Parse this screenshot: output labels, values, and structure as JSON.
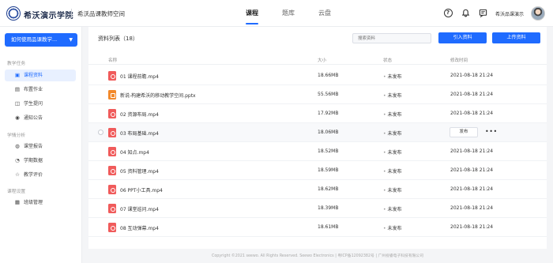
{
  "header": {
    "school_name": "希沃演示学院",
    "space_name": "希沃品课教师空间",
    "nav": [
      {
        "label": "课程",
        "active": true
      },
      {
        "label": "题库",
        "active": false
      },
      {
        "label": "云盘",
        "active": false
      }
    ],
    "icons": [
      "help-icon",
      "bell-icon",
      "message-icon"
    ],
    "user_name": "希沃品课演示"
  },
  "sidebar": {
    "selector_label": "如何使用品课教学...",
    "groups": [
      {
        "title": "教学任务",
        "items": [
          {
            "label": "课程资料",
            "icon": "video-icon",
            "active": true
          },
          {
            "label": "布置作业",
            "icon": "homework-icon",
            "active": false
          },
          {
            "label": "学生提问",
            "icon": "question-icon",
            "active": false
          },
          {
            "label": "通知公告",
            "icon": "announce-icon",
            "active": false
          }
        ]
      },
      {
        "title": "学情分析",
        "items": [
          {
            "label": "课堂报告",
            "icon": "report-icon",
            "active": false
          },
          {
            "label": "学期数据",
            "icon": "data-icon",
            "active": false
          },
          {
            "label": "教学评价",
            "icon": "rating-icon",
            "active": false
          }
        ]
      },
      {
        "title": "课程设置",
        "items": [
          {
            "label": "班级管理",
            "icon": "class-icon",
            "active": false
          }
        ]
      }
    ]
  },
  "main": {
    "list_title": "资料列表（18）",
    "search_placeholder": "搜索资料",
    "import_label": "引入资料",
    "upload_label": "上传资料",
    "columns": {
      "name": "名称",
      "size": "大小",
      "status": "状态",
      "date": "修改时间"
    },
    "rows": [
      {
        "name": "01 课程前瞻.mp4",
        "type": "video",
        "size": "18.66MB",
        "status": "未发布",
        "date": "2021-08-18 21:24"
      },
      {
        "name": "新说-构建希沃的移动教学空间.pptx",
        "type": "ppt",
        "size": "55.56MB",
        "status": "未发布",
        "date": "2021-08-18 21:24"
      },
      {
        "name": "02 资源布局.mp4",
        "type": "video",
        "size": "17.92MB",
        "status": "未发布",
        "date": "2021-08-18 21:24"
      },
      {
        "name": "03 布局基础.mp4",
        "type": "video",
        "size": "18.06MB",
        "status": "未发布",
        "date": "",
        "hover": true
      },
      {
        "name": "04 知点.mp4",
        "type": "video",
        "size": "18.52MB",
        "status": "未发布",
        "date": "2021-08-18 21:24"
      },
      {
        "name": "05 资料管理.mp4",
        "type": "video",
        "size": "18.59MB",
        "status": "未发布",
        "date": "2021-08-18 21:24"
      },
      {
        "name": "06 PPT小工具.mp4",
        "type": "video",
        "size": "18.62MB",
        "status": "未发布",
        "date": "2021-08-18 21:24"
      },
      {
        "name": "07 课堂巡问.mp4",
        "type": "video",
        "size": "18.39MB",
        "status": "未发布",
        "date": "2021-08-18 21:24"
      },
      {
        "name": "08 互动弹幕.mp4",
        "type": "video",
        "size": "18.61MB",
        "status": "未发布",
        "date": "2021-08-18 21:24"
      }
    ],
    "publish_label": "发布",
    "more_label": "•••"
  },
  "footer": {
    "text": "Copyright ©2021 seewo. All Rights Reserved. Seewo Electronics | 粤ICP备12092382号 | 广州视睿电子科技有限公司"
  },
  "colors": {
    "accent": "#1f6bff",
    "video_icon": "#f05b5b",
    "ppt_icon": "#f2892b"
  }
}
